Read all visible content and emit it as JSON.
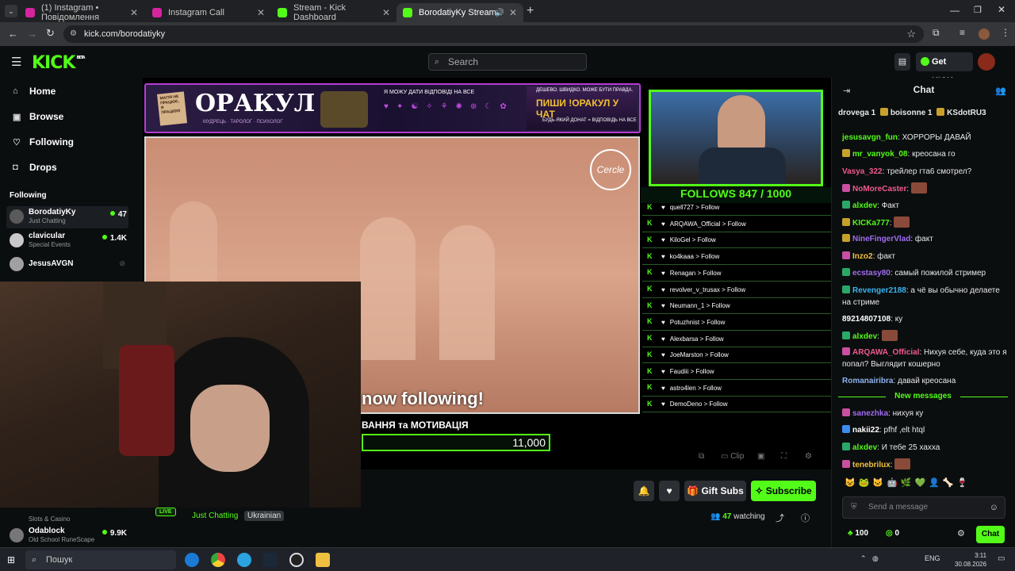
{
  "browser": {
    "tabs": [
      {
        "label": "(1) Instagram • Повідомлення",
        "favicon_color": "#d6249f"
      },
      {
        "label": "Instagram Call",
        "favicon_color": "#d6249f"
      },
      {
        "label": "Stream - Kick Dashboard",
        "favicon_color": "#53fc18"
      },
      {
        "label": "BorodatiyKy Stream - Watc",
        "favicon_color": "#53fc18"
      }
    ],
    "url": "kick.com/borodatiyky"
  },
  "header": {
    "logo": "KICK",
    "logo_sup": "BETA",
    "search_placeholder": "Search",
    "get_kicks": "Get KICKs"
  },
  "sidebar": {
    "nav": [
      {
        "label": "Home",
        "icon": "home-icon"
      },
      {
        "label": "Browse",
        "icon": "browse-icon"
      },
      {
        "label": "Following",
        "icon": "heart-icon"
      },
      {
        "label": "Drops",
        "icon": "drops-icon"
      }
    ],
    "following_title": "Following",
    "following": [
      {
        "name": "BorodatiyKy",
        "category": "Just Chatting",
        "viewers": "47"
      },
      {
        "name": "clavicular",
        "category": "Special Events",
        "viewers": "1.4K"
      },
      {
        "name": "JesusAVGN",
        "category": "",
        "viewers": ""
      }
    ],
    "following_bottom": [
      {
        "name": "Odablock",
        "category": "Old School RuneScape",
        "viewers": "9.9K"
      }
    ],
    "partial_item": {
      "category": "Slots & Casino"
    }
  },
  "overlay": {
    "banner_title": "ОРАКУЛ",
    "banner_sub": "МУДРЕЦЬ · ТАРОЛОГ · ПСИХОЛОГ",
    "banner_question": "Я МОЖУ ДАТИ ВІДПОВІДІ НА ВСЕ",
    "banner_tag": "ДЕШЕВО. ШВИДКО. МОЖЕ БУТИ ПРАВДА.",
    "banner_cta": "ПИШИ !ОРАКУЛ У ЧАТ",
    "banner_cta_sub": "БУДЬ-ЯКИЙ ДОНАТ = ВІДПОВІДЬ НА ВСЕ",
    "banner_left": "МАГІЯ НЕ ПРАЦЮЄ, Я ПРАЦЮЮ",
    "scene_logo": "Cercle",
    "follows": "FOLLOWS 847 / 1000",
    "followers": [
      "quell727",
      "ARQAWA_Official",
      "KiloGel",
      "ko4kaaa",
      "Renagan",
      "revolver_v_trusax",
      "Neumann_1",
      "Potuzhnist",
      "Alexbarsa",
      "JoeMarston",
      "Faudiii",
      "astro4len",
      "DemoDeno"
    ],
    "follow_suffix": "> Follow",
    "now_following": "now following!",
    "motivation": "ВАННЯ та МОТИВАЦІЯ",
    "goal": "11,000",
    "clip_label": "Clip"
  },
  "stream": {
    "live": "LIVE",
    "category": "Just Chatting",
    "language": "Ukrainian",
    "watching_count": "47",
    "watching_label": "watching",
    "gift_subs": "Gift Subs",
    "subscribe": "Subscribe"
  },
  "chat": {
    "title": "Chat",
    "gifters": [
      "drovega 1",
      "boisonne 1",
      "KSdotRU3"
    ],
    "messages": [
      {
        "user": "jesusavgn_fun",
        "text": "ХОРРОРЫ ДАВАЙ",
        "color": "#53fc18",
        "badge": ""
      },
      {
        "user": "mr_vanyok_08",
        "text": "креосана го",
        "color": "#53fc18",
        "badge": "#c8a12a"
      },
      {
        "user": "Vasya_322",
        "text": "трейлер гта6 смотрел?",
        "color": "#f05a8c",
        "badge": ""
      },
      {
        "user": "NoMoreCaster",
        "text": "",
        "color": "#f05a8c",
        "badge": "#c94fa0"
      },
      {
        "user": "alxdev",
        "text": "Факт",
        "color": "#53fc18",
        "badge": "#2aa86a"
      },
      {
        "user": "KICKa777",
        "text": "",
        "color": "#53fc18",
        "badge": "#c8a12a"
      },
      {
        "user": "NineFingerVlad",
        "text": "факт",
        "color": "#a06cf0",
        "badge": "#c8a12a"
      },
      {
        "user": "Inzo2",
        "text": "факт",
        "color": "#f0c040",
        "badge": "#c94fa0"
      },
      {
        "user": "ecstasy80",
        "text": "самый пожилой стример",
        "color": "#a06cf0",
        "badge": "#2aa86a"
      },
      {
        "user": "Revenger2188",
        "text": "а чё вы обычно делаете на стриме",
        "color": "#3cb4f0",
        "badge": "#2aa86a"
      },
      {
        "user": "89214807108",
        "text": "ку",
        "color": "#ffffff",
        "badge": ""
      },
      {
        "user": "alxdev",
        "text": "",
        "color": "#53fc18",
        "badge": "#2aa86a"
      },
      {
        "user": "ARQAWA_Official",
        "text": "Нихуя себе, куда это я попал? Выглядит кошерно",
        "color": "#f05a8c",
        "badge": "#c94fa0"
      },
      {
        "user": "Romanairibra",
        "text": "давай креосана",
        "color": "#8cb4f0",
        "badge": ""
      }
    ],
    "new_messages": "New messages",
    "new": [
      {
        "user": "sanezhka",
        "text": "нихуя ку",
        "color": "#a06cf0",
        "badge": "#c94fa0"
      },
      {
        "user": "nakii22",
        "text": "pfhf ,elt htql",
        "color": "#ffffff",
        "badge": "#3c8cf0"
      },
      {
        "user": "alxdev",
        "text": "И тебе 25 хахха",
        "color": "#53fc18",
        "badge": "#2aa86a"
      },
      {
        "user": "tenebrilux",
        "text": "",
        "color": "#f0c040",
        "badge": "#c94fa0"
      }
    ],
    "input_placeholder": "Send a message",
    "points": "100",
    "kicks": "0",
    "chat_button": "Chat"
  },
  "taskbar": {
    "search": "Пошук",
    "lang": "ENG",
    "time": "3:11",
    "date": "30.08.2026"
  }
}
